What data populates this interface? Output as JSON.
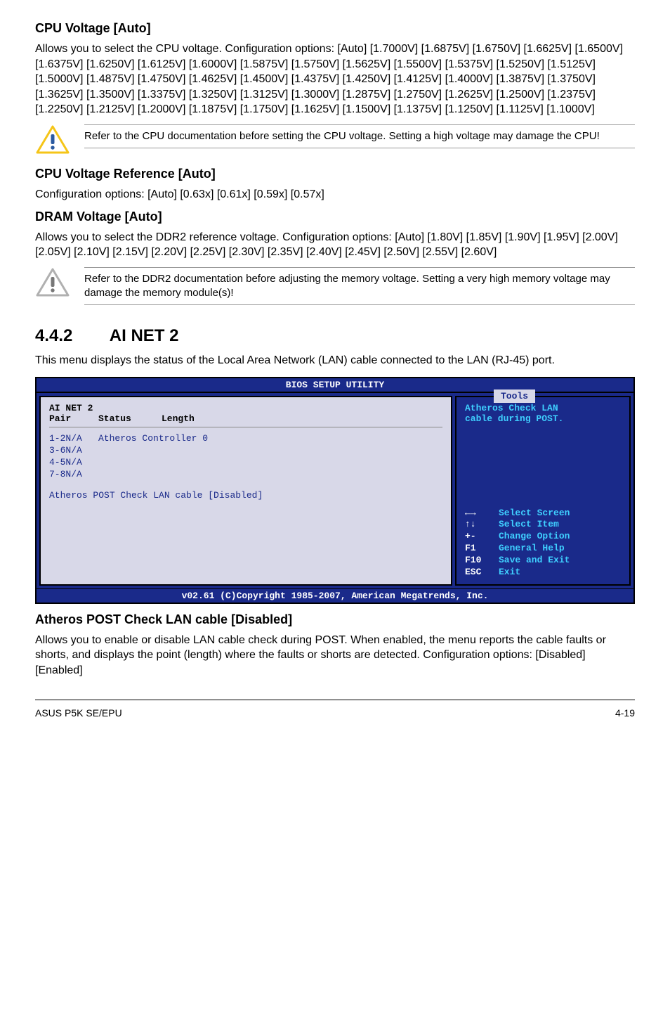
{
  "cpuVoltage": {
    "heading": "CPU Voltage [Auto]",
    "body": "Allows you to select the CPU voltage. Configuration options: [Auto] [1.7000V] [1.6875V] [1.6750V] [1.6625V] [1.6500V] [1.6375V] [1.6250V] [1.6125V] [1.6000V] [1.5875V] [1.5750V] [1.5625V] [1.5500V] [1.5375V] [1.5250V] [1.5125V] [1.5000V] [1.4875V] [1.4750V] [1.4625V] [1.4500V] [1.4375V] [1.4250V] [1.4125V] [1.4000V] [1.3875V] [1.3750V] [1.3625V] [1.3500V] [1.3375V] [1.3250V] [1.3125V] [1.3000V] [1.2875V] [1.2750V] [1.2625V] [1.2500V] [1.2375V] [1.2250V] [1.2125V] [1.2000V] [1.1875V] [1.1750V] [1.1625V] [1.1500V] [1.1375V] [1.1250V] [1.1125V] [1.1000V]",
    "note": "Refer to the CPU documentation before setting the CPU voltage. Setting a high voltage may damage the CPU!"
  },
  "cpuVoltageRef": {
    "heading": "CPU Voltage Reference [Auto]",
    "body": "Configuration options: [Auto] [0.63x] [0.61x] [0.59x] [0.57x]"
  },
  "dramVoltage": {
    "heading": "DRAM Voltage [Auto]",
    "body": "Allows you to select the DDR2 reference voltage. Configuration options: [Auto] [1.80V] [1.85V] [1.90V] [1.95V] [2.00V] [2.05V] [2.10V] [2.15V] [2.20V] [2.25V] [2.30V] [2.35V] [2.40V] [2.45V] [2.50V] [2.55V] [2.60V]",
    "note": "Refer to the DDR2 documentation before adjusting the memory voltage. Setting a very high memory voltage may damage the memory module(s)!"
  },
  "section442": {
    "number": "4.4.2",
    "title": "AI NET 2",
    "intro": "This menu displays the status of the Local Area Network (LAN) cable connected to the LAN (RJ-45) port."
  },
  "bios": {
    "title": "BIOS SETUP UTILITY",
    "tab": "Tools",
    "panelTitle": "AI NET 2",
    "colPair": "Pair",
    "colStatus": "Status",
    "colLength": "Length",
    "row1pair": "1-2N/A",
    "row1status": "Atheros Controller 0",
    "row2pair": "3-6N/A",
    "row3pair": "4-5N/A",
    "row4pair": "7-8N/A",
    "postCheck": "Atheros POST Check LAN cable [Disabled]",
    "helpLine1": "Atheros Check LAN",
    "helpLine2": "cable during POST.",
    "keySelectScreen": "Select Screen",
    "keySelectItem": "Select Item",
    "keyChangeOption": "Change Option",
    "keyGeneralHelp": "General Help",
    "keySaveExit": "Save and Exit",
    "keyExit": "Exit",
    "symArrows": "←→",
    "symUpDown": "↑↓",
    "symPlusMinus": "+-",
    "symF1": "F1",
    "symF10": "F10",
    "symEsc": "ESC",
    "footer": "v02.61 (C)Copyright 1985-2007, American Megatrends, Inc."
  },
  "atherosPost": {
    "heading": "Atheros POST Check LAN cable [Disabled]",
    "body": "Allows you to enable or disable LAN cable check during POST. When enabled, the menu reports the cable faults or shorts, and displays the point (length) where the faults or shorts are detected. Configuration options: [Disabled] [Enabled]"
  },
  "footer": {
    "left": "ASUS P5K SE/EPU",
    "right": "4-19"
  }
}
